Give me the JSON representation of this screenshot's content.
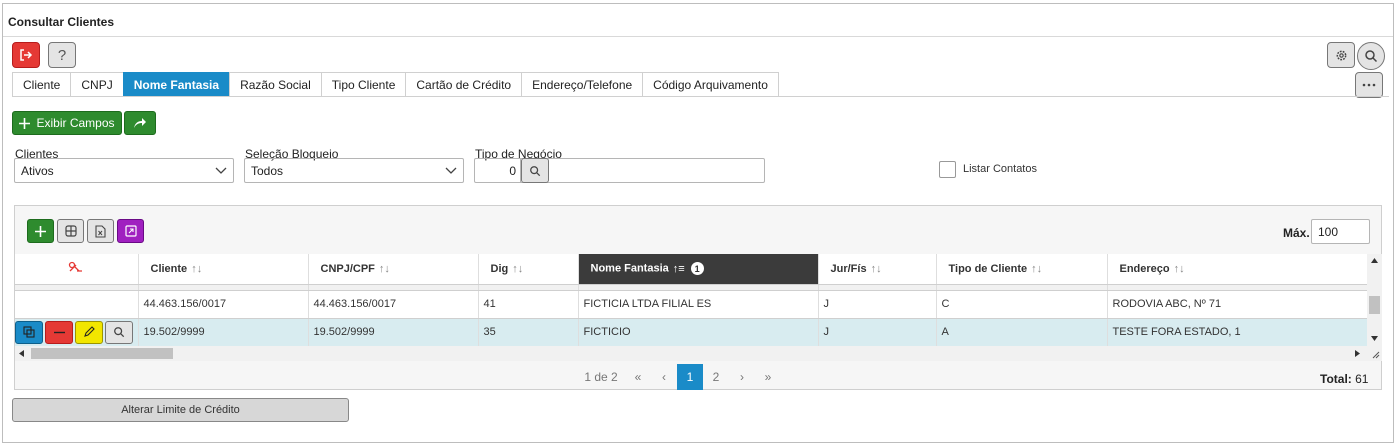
{
  "window": {
    "title": "Consultar Clientes"
  },
  "toolbar": {
    "help_label": "?"
  },
  "tabs": [
    {
      "label": "Cliente"
    },
    {
      "label": "CNPJ"
    },
    {
      "label": "Nome Fantasia",
      "active": true
    },
    {
      "label": "Razão Social"
    },
    {
      "label": "Tipo Cliente"
    },
    {
      "label": "Cartão de Crédito"
    },
    {
      "label": "Endereço/Telefone"
    },
    {
      "label": "Código Arquivamento"
    }
  ],
  "actions": {
    "exibir_label": "Exibir Campos"
  },
  "filters": {
    "clientes": {
      "label": "Clientes",
      "value": "Ativos"
    },
    "selecao": {
      "label": "Seleção Bloqueio",
      "value": "Todos"
    },
    "tipo_negocio": {
      "label": "Tipo de Negócio",
      "value": "0"
    },
    "listar_contatos": {
      "label": "Listar Contatos",
      "checked": false
    }
  },
  "grid": {
    "max_label": "Máx.",
    "max_value": "100",
    "columns": [
      {
        "label": ""
      },
      {
        "label": "Cliente"
      },
      {
        "label": "CNPJ/CPF"
      },
      {
        "label": "Dig"
      },
      {
        "label": "Nome Fantasia",
        "active": true,
        "badge": "1"
      },
      {
        "label": "Jur/Fís"
      },
      {
        "label": "Tipo de Cliente"
      },
      {
        "label": "Endereço"
      }
    ],
    "rows": [
      [
        "",
        "44.463.156/0017",
        "44.463.156/0017",
        "41",
        "FICTICIA LTDA  FILIAL ES",
        "J",
        "C",
        "RODOVIA ABC, Nº 71"
      ],
      [
        "",
        "19.502/9999",
        "19.502/9999",
        "35",
        "FICTICIO",
        "J",
        "A",
        "TESTE FORA ESTADO, 1"
      ]
    ],
    "sort_glyph": "↑↓",
    "sort_active_glyph": "↑≡"
  },
  "pagination": {
    "summary": "1 de 2",
    "first": "«",
    "prev": "‹",
    "pages": [
      "1",
      "2"
    ],
    "current": "1",
    "next": "›",
    "last": "»",
    "total_label": "Total:",
    "total_value": "61"
  },
  "footer": {
    "limite_label": "Alterar Limite de Crédito"
  },
  "colors": {
    "accent": "#1a8bc8",
    "green": "#2e8b2e",
    "red": "#e53935",
    "yellow": "#f2e600",
    "purple": "#a020c0"
  }
}
